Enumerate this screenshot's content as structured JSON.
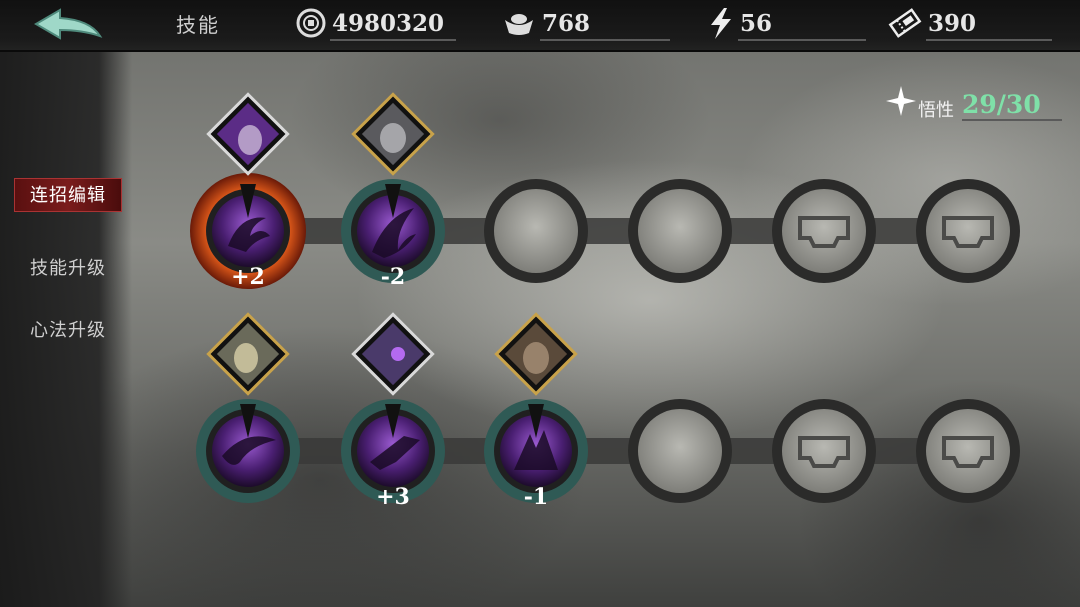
{
  "header": {
    "title": "技能",
    "resources": [
      {
        "name": "coins",
        "icon": "coin-icon",
        "value": "4980320"
      },
      {
        "name": "ingots",
        "icon": "ingot-icon",
        "value": "768"
      },
      {
        "name": "energy",
        "icon": "lightning-icon",
        "value": "56"
      },
      {
        "name": "tickets",
        "icon": "ticket-icon",
        "value": "390"
      }
    ]
  },
  "sidebar": {
    "items": [
      {
        "label": "连招编辑",
        "active": true
      },
      {
        "label": "技能升级",
        "active": false
      },
      {
        "label": "心法升级",
        "active": false
      }
    ]
  },
  "insight": {
    "label": "悟性",
    "value": "29/30",
    "color": "#7fe0a8"
  },
  "combo_rows": [
    {
      "slots": [
        {
          "state": "filled",
          "skill_icon": "claw-slash-icon",
          "portrait": "purple-hair-hero-portrait",
          "portrait_frame": "#d9d9d9",
          "modifier": "+2",
          "highlight": true
        },
        {
          "state": "filled",
          "skill_icon": "crescent-slash-icon",
          "portrait": "masked-warrior-portrait",
          "portrait_frame": "#c8a24a",
          "modifier": "-2",
          "highlight": false
        },
        {
          "state": "empty"
        },
        {
          "state": "empty"
        },
        {
          "state": "locked",
          "icon": "locked-slot-icon"
        },
        {
          "state": "locked",
          "icon": "locked-slot-icon"
        }
      ]
    },
    {
      "slots": [
        {
          "state": "filled",
          "skill_icon": "wing-sweep-icon",
          "portrait": "blonde-hero-portrait",
          "portrait_frame": "#c8a24a",
          "modifier": "",
          "highlight": false
        },
        {
          "state": "filled",
          "skill_icon": "rush-strike-icon",
          "portrait": "armored-knight-portrait",
          "portrait_frame": "#d9d9d9",
          "modifier": "+3",
          "highlight": false
        },
        {
          "state": "filled",
          "skill_icon": "spike-burst-icon",
          "portrait": "bearded-elder-portrait",
          "portrait_frame": "#c8a24a",
          "modifier": "-1",
          "highlight": false
        },
        {
          "state": "empty"
        },
        {
          "state": "locked",
          "icon": "locked-slot-icon"
        },
        {
          "state": "locked",
          "icon": "locked-slot-icon"
        }
      ]
    }
  ],
  "colors": {
    "accent_red": "#7a1c1c",
    "skill_purple": "#6b2fa0",
    "ring_teal": "#2f5a55",
    "highlight_orange": "#e05a1a"
  }
}
